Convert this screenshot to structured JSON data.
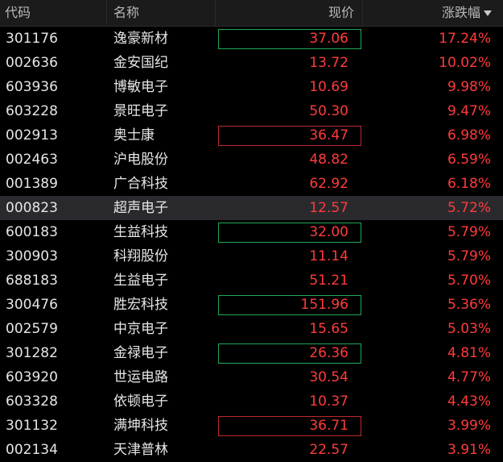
{
  "header": {
    "code": "代码",
    "name": "名称",
    "price": "现价",
    "change": "涨跌幅",
    "sort_icon": "sort-descending-icon"
  },
  "colors": {
    "up": "#ff3b3b",
    "text": "#e6e6e6",
    "header_bg": "#1b1b1b",
    "selected_bg": "#2a2a2e",
    "box_green": "#1fa75a",
    "box_red": "#c0292f"
  },
  "rows": [
    {
      "code": "301176",
      "name": "逸豪新材",
      "price": "37.06",
      "change": "17.24%",
      "box": "green",
      "selected": false
    },
    {
      "code": "002636",
      "name": "金安国纪",
      "price": "13.72",
      "change": "10.02%",
      "box": "",
      "selected": false
    },
    {
      "code": "603936",
      "name": "博敏电子",
      "price": "10.69",
      "change": "9.98%",
      "box": "",
      "selected": false
    },
    {
      "code": "603228",
      "name": "景旺电子",
      "price": "50.30",
      "change": "9.47%",
      "box": "",
      "selected": false
    },
    {
      "code": "002913",
      "name": "奥士康",
      "price": "36.47",
      "change": "6.98%",
      "box": "red",
      "selected": false
    },
    {
      "code": "002463",
      "name": "沪电股份",
      "price": "48.82",
      "change": "6.59%",
      "box": "",
      "selected": false
    },
    {
      "code": "001389",
      "name": "广合科技",
      "price": "62.92",
      "change": "6.18%",
      "box": "",
      "selected": false
    },
    {
      "code": "000823",
      "name": "超声电子",
      "price": "12.57",
      "change": "5.72%",
      "box": "",
      "selected": true
    },
    {
      "code": "600183",
      "name": "生益科技",
      "price": "32.00",
      "change": "5.79%",
      "box": "green",
      "selected": false
    },
    {
      "code": "300903",
      "name": "科翔股份",
      "price": "11.14",
      "change": "5.79%",
      "box": "",
      "selected": false
    },
    {
      "code": "688183",
      "name": "生益电子",
      "price": "51.21",
      "change": "5.70%",
      "box": "",
      "selected": false
    },
    {
      "code": "300476",
      "name": "胜宏科技",
      "price": "151.96",
      "change": "5.36%",
      "box": "green",
      "selected": false
    },
    {
      "code": "002579",
      "name": "中京电子",
      "price": "15.65",
      "change": "5.03%",
      "box": "",
      "selected": false
    },
    {
      "code": "301282",
      "name": "金禄电子",
      "price": "26.36",
      "change": "4.81%",
      "box": "green",
      "selected": false
    },
    {
      "code": "603920",
      "name": "世运电路",
      "price": "30.54",
      "change": "4.77%",
      "box": "",
      "selected": false
    },
    {
      "code": "603328",
      "name": "依顿电子",
      "price": "10.37",
      "change": "4.43%",
      "box": "",
      "selected": false
    },
    {
      "code": "301132",
      "name": "满坤科技",
      "price": "36.71",
      "change": "3.99%",
      "box": "red",
      "selected": false
    },
    {
      "code": "002134",
      "name": "天津普林",
      "price": "22.57",
      "change": "3.91%",
      "box": "",
      "selected": false
    }
  ]
}
